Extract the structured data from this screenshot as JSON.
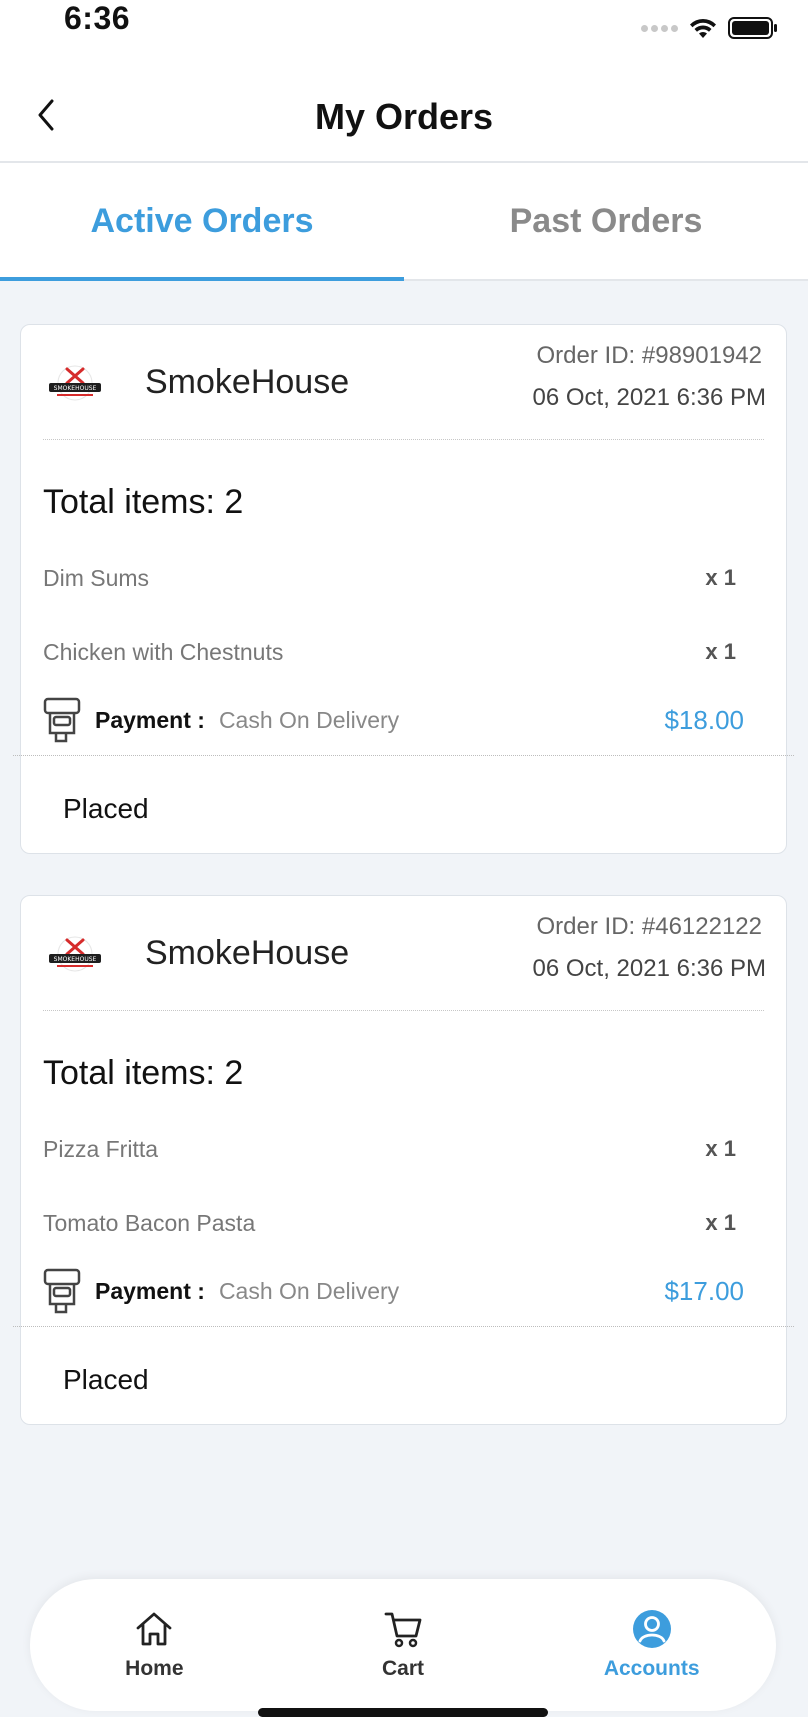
{
  "status_bar": {
    "time": "6:36"
  },
  "header": {
    "title": "My Orders"
  },
  "tabs": [
    {
      "label": "Active Orders",
      "active": true
    },
    {
      "label": "Past Orders",
      "active": false
    }
  ],
  "orders": [
    {
      "store": "SmokeHouse",
      "order_id": "Order ID: #98901942",
      "date": "06 Oct, 2021 6:36 PM",
      "total_items": "Total items: 2",
      "items": [
        {
          "name": "Dim Sums",
          "qty": "x 1"
        },
        {
          "name": "Chicken with Chestnuts",
          "qty": "x 1"
        }
      ],
      "payment_label": "Payment :",
      "payment_method": "Cash On Delivery",
      "amount": "$18.00",
      "status": "Placed"
    },
    {
      "store": "SmokeHouse",
      "order_id": "Order ID: #46122122",
      "date": "06 Oct, 2021 6:36 PM",
      "total_items": "Total items: 2",
      "items": [
        {
          "name": "Pizza Fritta",
          "qty": "x 1"
        },
        {
          "name": "Tomato Bacon Pasta",
          "qty": "x 1"
        }
      ],
      "payment_label": "Payment :",
      "payment_method": "Cash On Delivery",
      "amount": "$17.00",
      "status": "Placed"
    }
  ],
  "logo_text": "SMOKEHOUSE",
  "bottom_nav": [
    {
      "label": "Home",
      "icon": "home-icon",
      "active": false
    },
    {
      "label": "Cart",
      "icon": "cart-icon",
      "active": false
    },
    {
      "label": "Accounts",
      "icon": "account-icon",
      "active": true
    }
  ],
  "colors": {
    "accent": "#3d9ddd",
    "background": "#f1f4f8",
    "logo_red": "#d62b2b"
  }
}
